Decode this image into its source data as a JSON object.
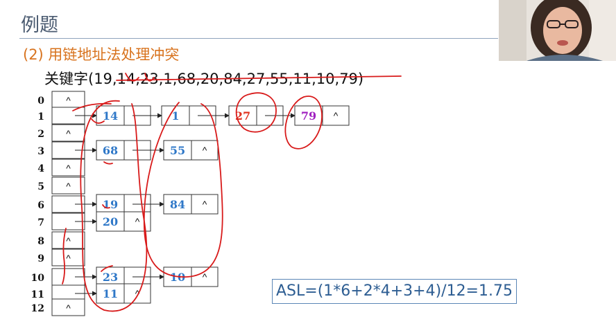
{
  "title": "例题",
  "subtitle": "(2) 用链地址法处理冲突",
  "keywords": "关键字(19,14,23,1,68,20,84,27,55,11,10,79)",
  "asl": "ASL=(1*6+2*4+3+4)/12=1.75",
  "null_symbol": "^",
  "table_indices": [
    "0",
    "1",
    "2",
    "3",
    "4",
    "5",
    "6",
    "7",
    "8",
    "9",
    "10",
    "11",
    "12"
  ],
  "chains": [
    {
      "slot": 1,
      "nodes": [
        "14",
        "1",
        "27",
        "79"
      ]
    },
    {
      "slot": 3,
      "nodes": [
        "68",
        "55"
      ]
    },
    {
      "slot": 6,
      "nodes": [
        "19",
        "84"
      ]
    },
    {
      "slot": 7,
      "nodes": [
        "20"
      ]
    },
    {
      "slot": 10,
      "nodes": [
        "23",
        "10"
      ]
    },
    {
      "slot": 11,
      "nodes": [
        "11"
      ]
    }
  ],
  "node_colors": {
    "default": "#2f78c8",
    "27": "#e0331f",
    "79": "#a020c0"
  },
  "annotation_color": "#d81a1a"
}
